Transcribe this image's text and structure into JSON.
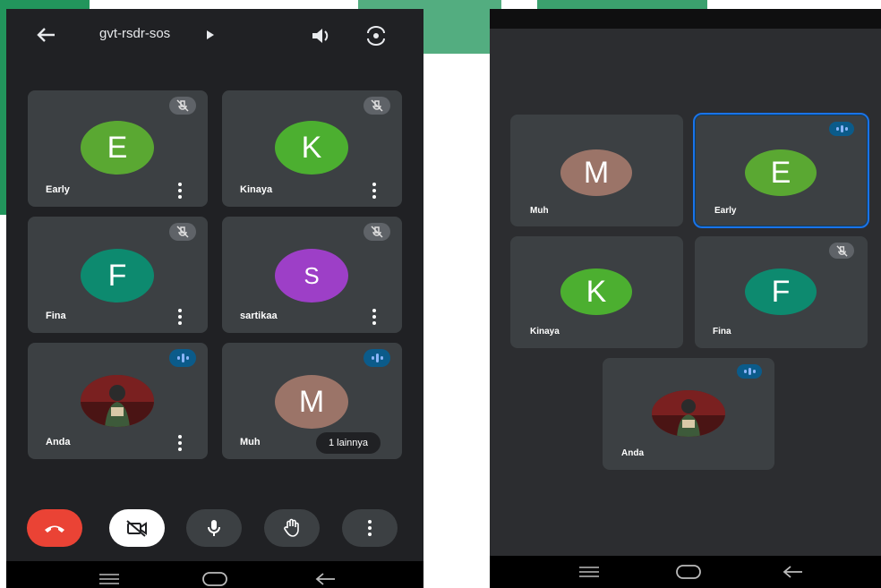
{
  "left_phone": {
    "meeting_code": "gvt-rsdr-sos",
    "participants": [
      {
        "name": "Early",
        "initial": "E",
        "color": "#5aa832",
        "status": "muted"
      },
      {
        "name": "Kinaya",
        "initial": "K",
        "color": "#4caf30",
        "status": "muted"
      },
      {
        "name": "Fina",
        "initial": "F",
        "color": "#0d8a6f",
        "status": "muted"
      },
      {
        "name": "sartikaa",
        "initial": "S",
        "color": "#9d3fc7",
        "status": "muted"
      },
      {
        "name": "Anda",
        "initial": "",
        "color": "#6b1d1d",
        "status": "speaking"
      },
      {
        "name": "Muh",
        "initial": "M",
        "color": "#9b7468",
        "status": "speaking"
      }
    ],
    "more_label": "1 lainnya",
    "controls": [
      "end-call",
      "camera-off",
      "microphone",
      "raise-hand",
      "more-options"
    ]
  },
  "right_phone": {
    "participants": [
      {
        "name": "Muh",
        "initial": "M",
        "color": "#9b7468",
        "status": "none"
      },
      {
        "name": "Early",
        "initial": "E",
        "color": "#5aa832",
        "status": "speaking"
      },
      {
        "name": "Kinaya",
        "initial": "K",
        "color": "#4caf30",
        "status": "none"
      },
      {
        "name": "Fina",
        "initial": "F",
        "color": "#0d8a6f",
        "status": "muted"
      },
      {
        "name": "Anda",
        "initial": "",
        "color": "#6b1d1d",
        "status": "speaking"
      }
    ]
  },
  "colors": {
    "end_call": "#ea4335",
    "speaking_badge": "#0b5b8a",
    "active_border": "#1a73e8",
    "watermark": "#0a8a4a"
  }
}
